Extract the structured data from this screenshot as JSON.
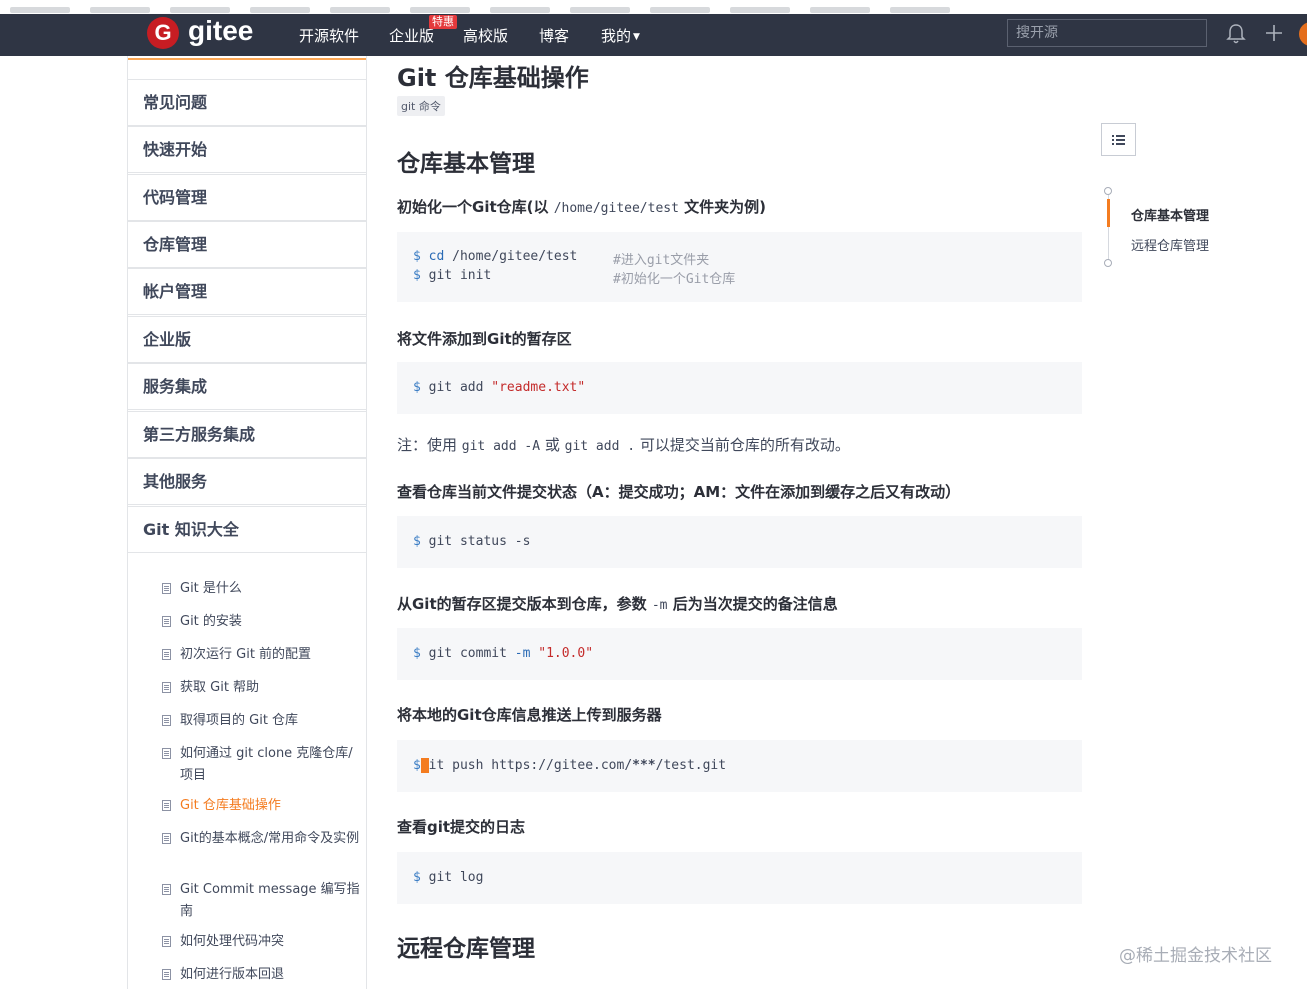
{
  "brand": {
    "logo_letter": "G",
    "name": "gitee",
    "color": "#c71d23"
  },
  "nav": {
    "items": [
      "开源软件",
      "企业版",
      "高校版",
      "博客",
      "我的"
    ],
    "badge": "特惠",
    "search_placeholder": "搜开源"
  },
  "sidebar": {
    "sections": [
      "常见问题",
      "快速开始",
      "代码管理",
      "仓库管理",
      "帐户管理",
      "企业版",
      "服务集成",
      "第三方服务集成",
      "其他服务",
      "Git 知识大全"
    ],
    "sub_items": [
      "Git 是什么",
      "Git 的安装",
      "初次运行 Git 前的配置",
      "获取 Git 帮助",
      "取得项目的 Git 仓库",
      "如何通过 git clone 克隆仓库/项目",
      "Git 仓库基础操作",
      "Git的基本概念/常用命令及实例",
      "Git Commit message 编写指南",
      "如何处理代码冲突",
      "如何进行版本回退"
    ],
    "active_sub_index": 6
  },
  "article": {
    "title": "Git 仓库基础操作",
    "tag": "git 命令",
    "section1": "仓库基本管理",
    "init": {
      "heading_pre": "初始化一个Git仓库(以 ",
      "heading_code": "/home/gitee/test",
      "heading_post": " 文件夹为例)",
      "line1_prompt": "$",
      "line1_cmd": "cd",
      "line1_arg": "/home/gitee/test",
      "line1_comment": "#进入git文件夹",
      "line2_prompt": "$",
      "line2_cmd": "git init",
      "line2_comment": "#初始化一个Git仓库"
    },
    "add": {
      "heading": "将文件添加到Git的暂存区",
      "prompt": "$",
      "cmd": "git add",
      "arg": "\"readme.txt\""
    },
    "note": {
      "pre": "注：使用 ",
      "code1": "git add -A",
      "mid": "或 ",
      "code2": "git add .",
      "post": " 可以提交当前仓库的所有改动。"
    },
    "status": {
      "heading": "查看仓库当前文件提交状态（A：提交成功；AM：文件在添加到缓存之后又有改动）",
      "prompt": "$",
      "cmd": "git status -s"
    },
    "commit": {
      "heading_pre": "从Git的暂存区提交版本到仓库，参数 ",
      "heading_code": "-m",
      "heading_post": " 后为当次提交的备注信息",
      "prompt": "$",
      "cmd": "git commit",
      "flag": "-m",
      "arg": "\"1.0.0\""
    },
    "push": {
      "heading": "将本地的Git仓库信息推送上传到服务器",
      "prompt": "$",
      "cursor_char": "g",
      "cmd_rest": "it push https://gitee.com/",
      "stars": "***",
      "cmd_tail": "/test.git"
    },
    "log": {
      "heading": "查看git提交的日志",
      "prompt": "$",
      "cmd": "git log"
    },
    "section2": "远程仓库管理"
  },
  "toc": {
    "items": [
      "仓库基本管理",
      "远程仓库管理"
    ],
    "active_index": 0
  },
  "watermark": "@稀土掘金技术社区",
  "colors": {
    "accent": "#f47c20",
    "topbar": "#2f3544",
    "code_bg": "#f6f7f9",
    "string": "#c42b2b"
  }
}
